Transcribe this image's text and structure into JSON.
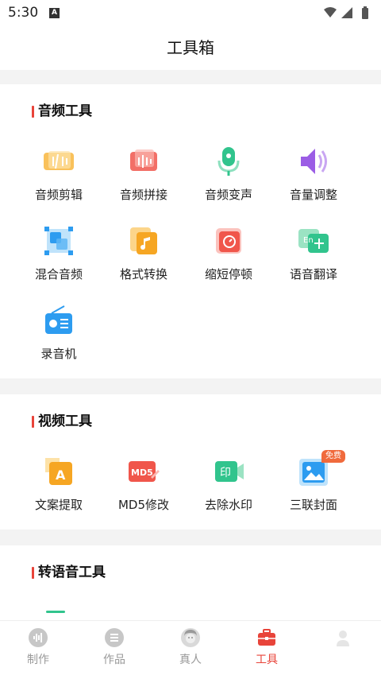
{
  "status_bar": {
    "time": "5:30",
    "notification_letter": "A"
  },
  "header": {
    "title": "工具箱"
  },
  "sections": [
    {
      "title": "音频工具",
      "tools": [
        {
          "label": "音频剪辑",
          "icon": "audio-cut-icon"
        },
        {
          "label": "音频拼接",
          "icon": "audio-join-icon"
        },
        {
          "label": "音频变声",
          "icon": "voice-changer-icon"
        },
        {
          "label": "音量调整",
          "icon": "volume-adjust-icon"
        },
        {
          "label": "混合音频",
          "icon": "audio-mix-icon"
        },
        {
          "label": "格式转换",
          "icon": "format-convert-icon"
        },
        {
          "label": "缩短停顿",
          "icon": "shorten-pause-icon"
        },
        {
          "label": "语音翻译",
          "icon": "voice-translate-icon"
        },
        {
          "label": "录音机",
          "icon": "radio-recorder-icon"
        }
      ]
    },
    {
      "title": "视频工具",
      "tools": [
        {
          "label": "文案提取",
          "icon": "text-extract-icon"
        },
        {
          "label": "MD5修改",
          "icon": "md5-edit-icon",
          "icon_text": "MD5"
        },
        {
          "label": "去除水印",
          "icon": "remove-watermark-icon",
          "icon_text": "印"
        },
        {
          "label": "三联封面",
          "icon": "triple-cover-icon",
          "badge": "免费"
        }
      ]
    },
    {
      "title": "转语音工具",
      "tools": []
    }
  ],
  "tabbar": {
    "items": [
      {
        "label": "制作",
        "icon": "make-waveform-icon",
        "active": false
      },
      {
        "label": "作品",
        "icon": "works-list-icon",
        "active": false
      },
      {
        "label": "真人",
        "icon": "real-person-avatar-icon",
        "active": false
      },
      {
        "label": "工具",
        "icon": "toolbox-icon",
        "active": true
      },
      {
        "label": "",
        "icon": "profile-icon",
        "active": false
      }
    ]
  },
  "colors": {
    "accent": "#e8443a",
    "orange": "#f6a623",
    "red": "#f0564b",
    "green": "#31c48d",
    "purple": "#9b5de5",
    "blue": "#2d9cf0",
    "background": "#f3f3f3"
  }
}
